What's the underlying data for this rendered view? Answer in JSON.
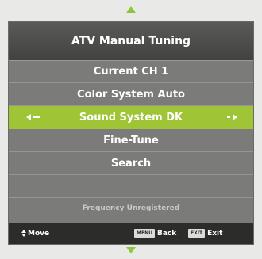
{
  "menu": {
    "title": "ATV Manual Tuning",
    "items": [
      {
        "label": "Current CH 1",
        "selected": false
      },
      {
        "label": "Color System Auto",
        "selected": false
      },
      {
        "label": "Sound System DK",
        "selected": true
      },
      {
        "label": "Fine-Tune",
        "selected": false
      },
      {
        "label": "Search",
        "selected": false
      }
    ],
    "status": "Frequency Unregistered"
  },
  "footer": {
    "move_label": "Move",
    "back_key": "MENU",
    "back_label": "Back",
    "exit_key": "EXIT",
    "exit_label": "Exit"
  },
  "colors": {
    "accent": "#9fc436",
    "panel": "#7b7b79",
    "footer": "#2c2c2a"
  },
  "icons": {
    "scroll_up": "triangle-up-icon",
    "scroll_down": "triangle-down-icon",
    "move": "up-down-arrows-icon"
  }
}
